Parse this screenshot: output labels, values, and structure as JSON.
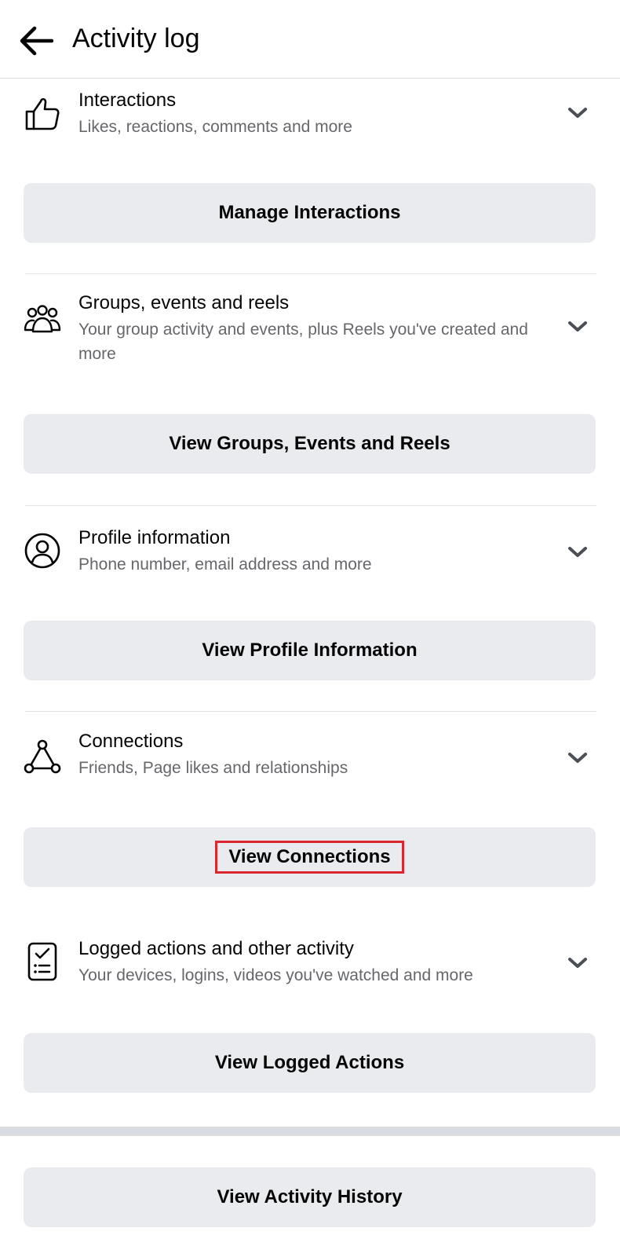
{
  "header": {
    "title": "Activity log",
    "back_icon": "back-arrow-icon"
  },
  "sections": [
    {
      "icon": "thumbs-up-icon",
      "title": "Interactions",
      "subtitle": "Likes, reactions, comments and more",
      "button_label": "Manage Interactions"
    },
    {
      "icon": "groups-icon",
      "title": "Groups, events and reels",
      "subtitle": "Your group activity and events, plus Reels you've created and more",
      "button_label": "View Groups, Events and Reels"
    },
    {
      "icon": "profile-icon",
      "title": "Profile information",
      "subtitle": "Phone number, email address and more",
      "button_label": "View Profile Information"
    },
    {
      "icon": "connections-icon",
      "title": "Connections",
      "subtitle": "Friends, Page likes and relationships",
      "button_label": "View Connections"
    },
    {
      "icon": "checklist-icon",
      "title": "Logged actions and other activity",
      "subtitle": "Your devices, logins, videos you've watched and more",
      "button_label": "View Logged Actions"
    }
  ],
  "footer": {
    "button_label": "View Activity History"
  },
  "colors": {
    "button_bg": "#e9ebee",
    "highlight": "#d9282f",
    "subtitle": "#65676b"
  }
}
